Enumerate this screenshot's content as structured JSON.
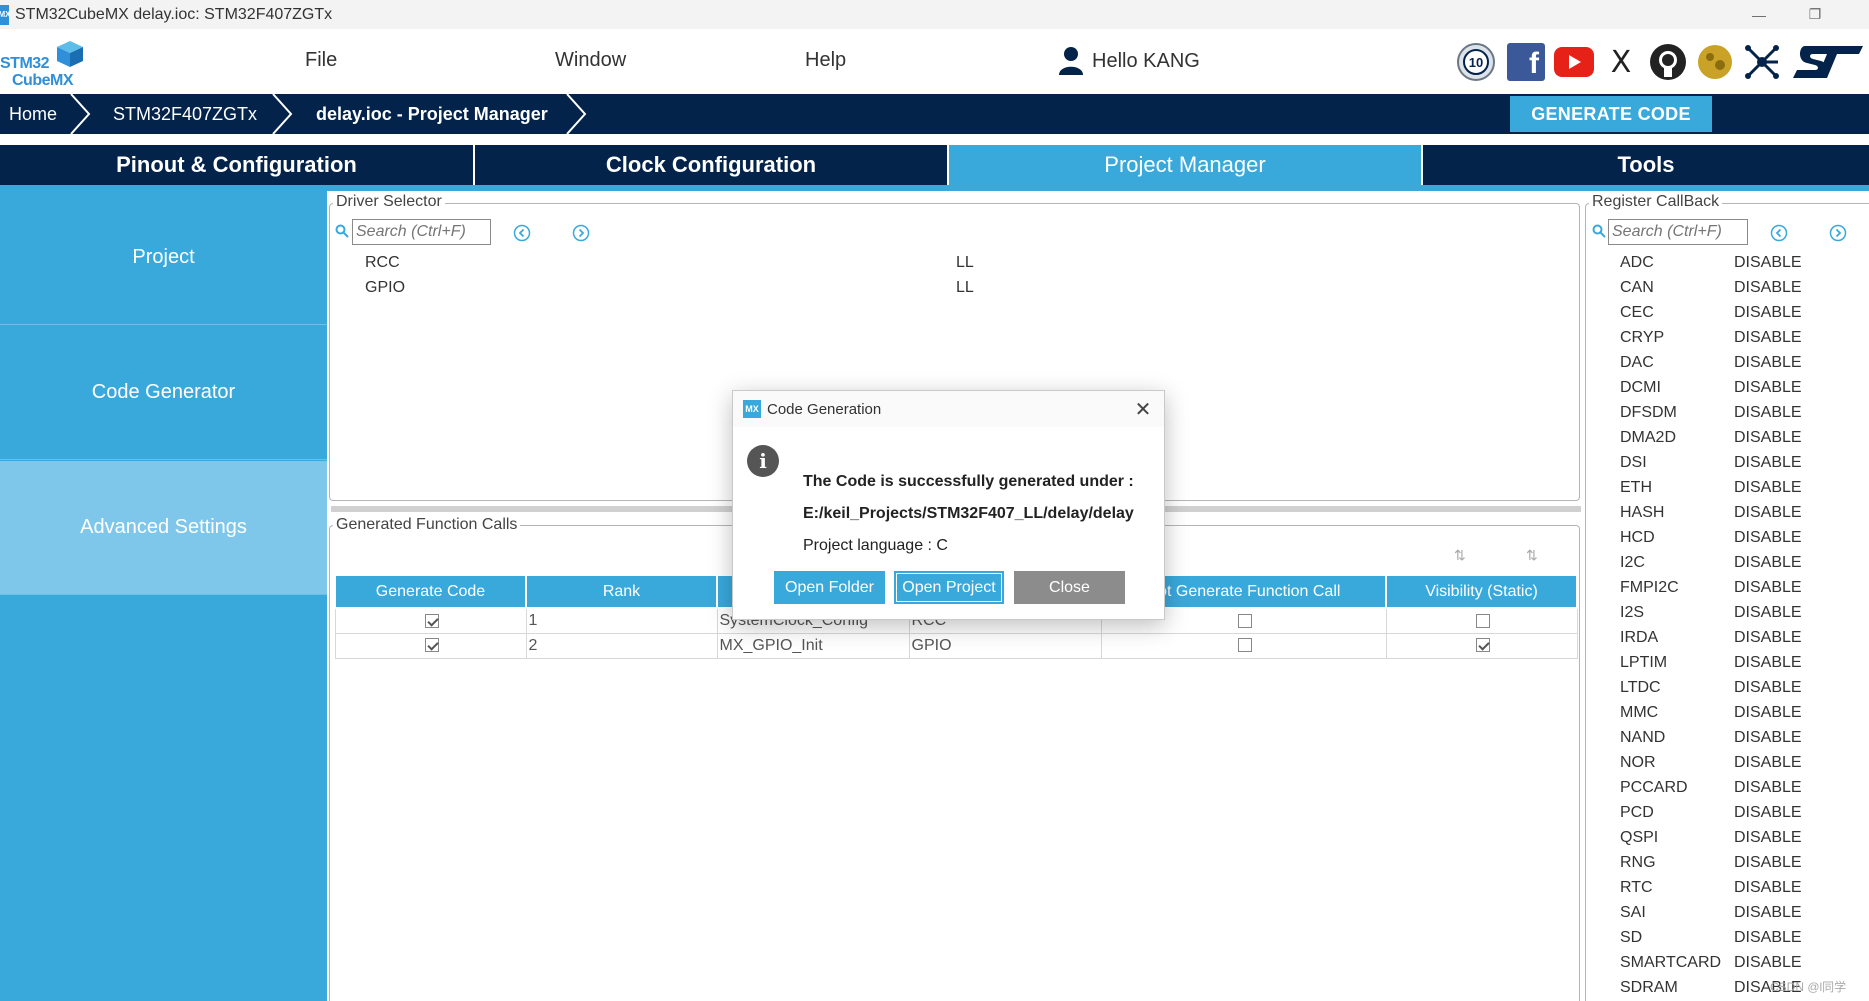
{
  "window": {
    "title": "STM32CubeMX delay.ioc: STM32F407ZGTx",
    "badge": "MX",
    "minimize": "—",
    "restore": "❐"
  },
  "logo": {
    "line1": "STM32",
    "line2": "CubeMX",
    "color": "#2f8fd8"
  },
  "menu": {
    "file": "File",
    "window": "Window",
    "help": "Help",
    "user": "Hello KANG"
  },
  "social": {
    "badge_text": "10",
    "facebook": "f",
    "x": "X"
  },
  "breadcrumb": {
    "home": "Home",
    "mcu": "STM32F407ZGTx",
    "project": "delay.ioc - Project Manager"
  },
  "generate_code": "GENERATE CODE",
  "tabs": {
    "pinout": "Pinout & Configuration",
    "clock": "Clock Configuration",
    "project_manager": "Project Manager",
    "tools": "Tools"
  },
  "sidebar": {
    "project": "Project",
    "code_generator": "Code Generator",
    "advanced_settings": "Advanced Settings"
  },
  "driver_selector": {
    "legend": "Driver Selector",
    "search_placeholder": "Search (Ctrl+F)",
    "rows": [
      {
        "name": "RCC",
        "driver": "LL"
      },
      {
        "name": "GPIO",
        "driver": "LL"
      }
    ]
  },
  "function_calls": {
    "legend": "Generated Function Calls",
    "headers": {
      "generate_code": "Generate Code",
      "rank": "Rank",
      "not_generate": "Not Generate Function Call",
      "visibility": "Visibility (Static)"
    },
    "rows": [
      {
        "generate": true,
        "rank": "1",
        "function": "SystemClock_Config",
        "ip": "RCC",
        "not_generate": false,
        "visibility": false
      },
      {
        "generate": true,
        "rank": "2",
        "function": "MX_GPIO_Init",
        "ip": "GPIO",
        "not_generate": false,
        "visibility": true
      }
    ]
  },
  "register_callback": {
    "legend": "Register CallBack",
    "search_placeholder": "Search (Ctrl+F)",
    "rows": [
      {
        "name": "ADC",
        "value": "DISABLE"
      },
      {
        "name": "CAN",
        "value": "DISABLE"
      },
      {
        "name": "CEC",
        "value": "DISABLE"
      },
      {
        "name": "CRYP",
        "value": "DISABLE"
      },
      {
        "name": "DAC",
        "value": "DISABLE"
      },
      {
        "name": "DCMI",
        "value": "DISABLE"
      },
      {
        "name": "DFSDM",
        "value": "DISABLE"
      },
      {
        "name": "DMA2D",
        "value": "DISABLE"
      },
      {
        "name": "DSI",
        "value": "DISABLE"
      },
      {
        "name": "ETH",
        "value": "DISABLE"
      },
      {
        "name": "HASH",
        "value": "DISABLE"
      },
      {
        "name": "HCD",
        "value": "DISABLE"
      },
      {
        "name": "I2C",
        "value": "DISABLE"
      },
      {
        "name": "FMPI2C",
        "value": "DISABLE"
      },
      {
        "name": "I2S",
        "value": "DISABLE"
      },
      {
        "name": "IRDA",
        "value": "DISABLE"
      },
      {
        "name": "LPTIM",
        "value": "DISABLE"
      },
      {
        "name": "LTDC",
        "value": "DISABLE"
      },
      {
        "name": "MMC",
        "value": "DISABLE"
      },
      {
        "name": "NAND",
        "value": "DISABLE"
      },
      {
        "name": "NOR",
        "value": "DISABLE"
      },
      {
        "name": "PCCARD",
        "value": "DISABLE"
      },
      {
        "name": "PCD",
        "value": "DISABLE"
      },
      {
        "name": "QSPI",
        "value": "DISABLE"
      },
      {
        "name": "RNG",
        "value": "DISABLE"
      },
      {
        "name": "RTC",
        "value": "DISABLE"
      },
      {
        "name": "SAI",
        "value": "DISABLE"
      },
      {
        "name": "SD",
        "value": "DISABLE"
      },
      {
        "name": "SMARTCARD",
        "value": "DISABLE"
      },
      {
        "name": "SDRAM",
        "value": "DISABLE"
      }
    ]
  },
  "dialog": {
    "badge": "MX",
    "title": "Code Generation",
    "close": "✕",
    "info": "i",
    "line1": "The Code is successfully generated under :",
    "line2": "E:/keil_Projects/STM32F407_LL/delay/delay",
    "line3": "Project language : C",
    "open_folder": "Open Folder",
    "open_project": "Open Project",
    "close_button": "Close"
  },
  "watermark": "CSDN @l同学",
  "colors": {
    "navy": "#03234b",
    "accent": "#39a9dc",
    "sidebar_active": "#7fc7ea",
    "close_button": "#8c8c8c"
  }
}
